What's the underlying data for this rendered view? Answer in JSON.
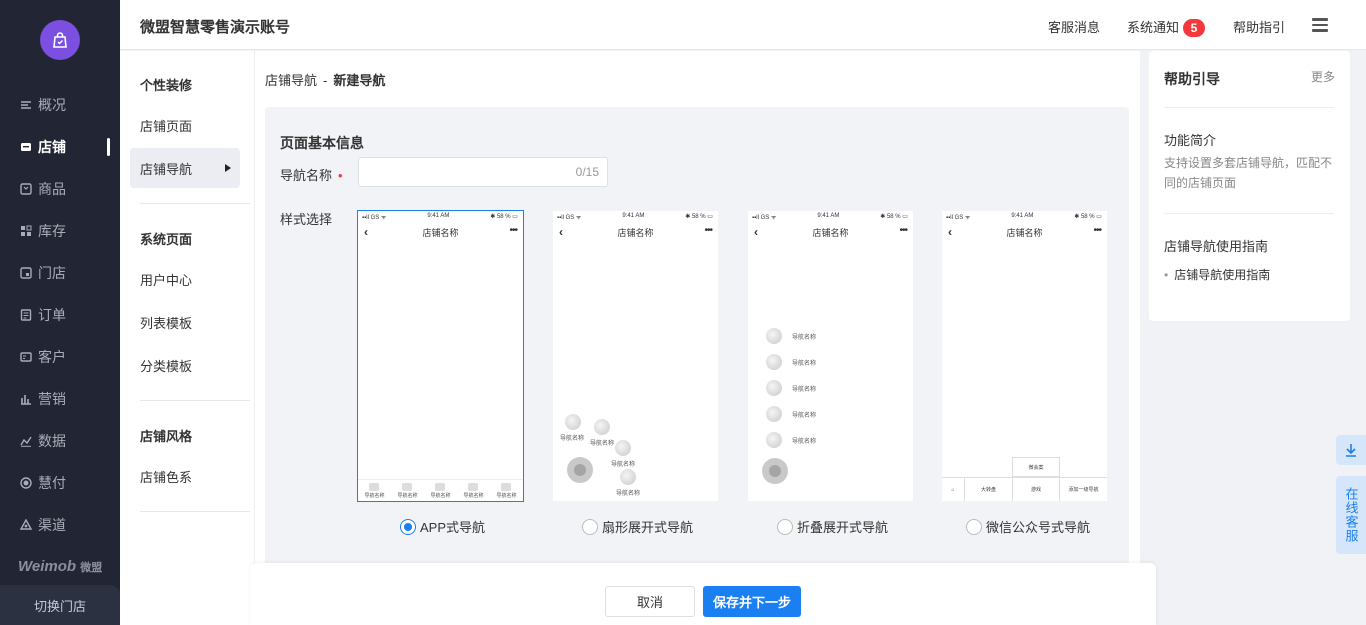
{
  "sidebar": {
    "items": [
      {
        "label": "概况",
        "icon": "overview-icon"
      },
      {
        "label": "店铺",
        "icon": "store-icon"
      },
      {
        "label": "商品",
        "icon": "goods-icon"
      },
      {
        "label": "库存",
        "icon": "inventory-icon"
      },
      {
        "label": "门店",
        "icon": "shop-icon"
      },
      {
        "label": "订单",
        "icon": "order-icon"
      },
      {
        "label": "客户",
        "icon": "customer-icon"
      },
      {
        "label": "营销",
        "icon": "marketing-icon"
      },
      {
        "label": "数据",
        "icon": "data-icon"
      },
      {
        "label": "慧付",
        "icon": "pay-icon"
      },
      {
        "label": "渠道",
        "icon": "channel-icon"
      }
    ],
    "active_index": 1,
    "brand": "Weimob",
    "brand_cn": "微盟",
    "switch_store": "切换门店"
  },
  "header": {
    "account": "微盟智慧零售演示账号",
    "service_msg": "客服消息",
    "system_notice": "系统通知",
    "notice_count": "5",
    "help_guide": "帮助指引"
  },
  "submenu": {
    "group1_title": "个性装修",
    "store_page": "店铺页面",
    "store_nav": "店铺导航",
    "group2_title": "系统页面",
    "user_center": "用户中心",
    "list_template": "列表模板",
    "category_template": "分类模板",
    "group3_title": "店铺风格",
    "store_color": "店铺色系"
  },
  "main": {
    "breadcrumb_parent": "店铺导航",
    "breadcrumb_sep": "-",
    "breadcrumb_current": "新建导航",
    "panel_title": "页面基本信息",
    "nav_name_label": "导航名称",
    "required_mark": "•",
    "nav_name_value": "",
    "nav_name_counter": "0/15",
    "style_label": "样式选择",
    "phone": {
      "status_left": "▪▪ll GS ᯤ",
      "status_time": "9:41 AM",
      "status_right": "✱ 58 % ▭",
      "title": "店铺名称",
      "back": "‹",
      "dots": "•••",
      "item_label": "导航名称",
      "wx_pop": "微会案",
      "wx_cells": [
        "大转盘",
        "游戏",
        "添加一级导航"
      ]
    },
    "styles": [
      {
        "label": "APP式导航",
        "selected": true
      },
      {
        "label": "扇形展开式导航",
        "selected": false
      },
      {
        "label": "折叠展开式导航",
        "selected": false
      },
      {
        "label": "微信公众号式导航",
        "selected": false
      }
    ]
  },
  "footer": {
    "cancel": "取消",
    "save_next": "保存并下一步"
  },
  "help": {
    "title": "帮助引导",
    "more": "更多",
    "feature_title": "功能简介",
    "feature_desc": "支持设置多套店铺导航，匹配不同的店铺页面",
    "guide_title": "店铺导航使用指南",
    "guide_link": "店铺导航使用指南"
  },
  "widgets": {
    "online_service": "在线客服"
  },
  "colors": {
    "sidebar_bg": "#212534",
    "accent": "#1a7ff0",
    "badge": "#f5383b",
    "logo": "#7b4fe0"
  }
}
